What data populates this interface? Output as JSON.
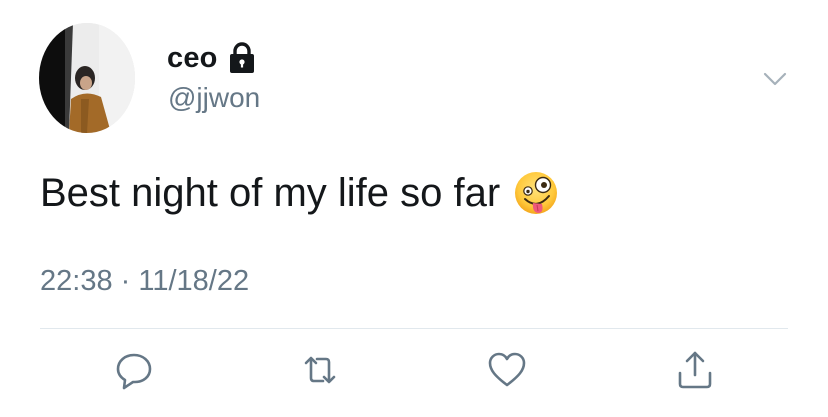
{
  "tweet": {
    "author": {
      "display_name": "ceo",
      "handle": "@jjwon",
      "protected": true
    },
    "text": "Best night of my life so far",
    "emoji": "zany-face-emoji",
    "meta": "22:38 · 11/18/22"
  },
  "icons": {
    "lock": "lock-icon",
    "caret": "chevron-down-icon",
    "reply": "reply-icon",
    "retweet": "retweet-icon",
    "like": "heart-icon",
    "share": "share-icon"
  },
  "colors": {
    "text_primary": "#14171a",
    "text_secondary": "#657786",
    "divider": "#e1e8ed",
    "icon_gray": "#657786"
  }
}
